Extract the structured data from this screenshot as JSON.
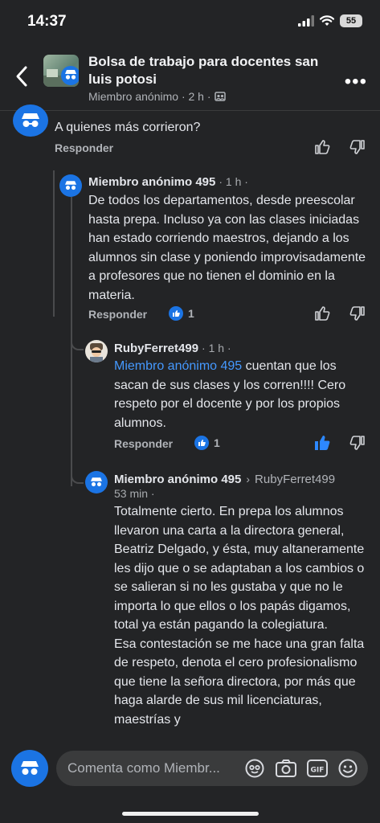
{
  "status_bar": {
    "time": "14:37",
    "battery": "55"
  },
  "header": {
    "group_title": "Bolsa de trabajo para docentes san luis potosi",
    "meta": "Miembro anónimo · 2 h ·"
  },
  "comments": {
    "top": {
      "text": "A quienes más corrieron?",
      "reply": "Responder"
    },
    "c1": {
      "author": "Miembro anónimo 495",
      "time": "· 1 h ·",
      "text": "De todos los departamentos, desde preescolar hasta prepa. Incluso ya con las clases iniciadas han estado corriendo maestros, dejando a los alumnos sin clase y poniendo improvisadamente a profesores que no tienen el dominio en la materia.",
      "reply": "Responder",
      "reactions": "1"
    },
    "c2": {
      "author": "RubyFerret499",
      "time": "· 1 h ·",
      "mention": "Miembro anónimo 495",
      "text": " cuentan que los sacan de sus clases y los  corren!!!! Cero respeto por el docente y por los propios alumnos.",
      "reply": "Responder",
      "reactions": "1"
    },
    "c3": {
      "author": "Miembro anónimo 495",
      "reply_to": "RubyFerret499",
      "time": "53 min ·",
      "text": "Totalmente cierto. En prepa los alumnos llevaron una carta a la directora general, Beatriz Delgado, y ésta, muy altaneramente les dijo que o se adaptaban a los cambios o se salieran si no les gustaba y que no le importa lo que ellos o los papás digamos, total ya están pagando la colegiatura.\nEsa contestación se me hace una gran falta de respeto, denota el cero profesionalismo que tiene la señora directora, por más que haga alarde de sus mil licenciaturas, maestrías y"
    }
  },
  "composer": {
    "placeholder": "Comenta como Miembr..."
  },
  "colors": {
    "accent": "#1b74e4",
    "link": "#4599ff",
    "background": "#232426"
  }
}
